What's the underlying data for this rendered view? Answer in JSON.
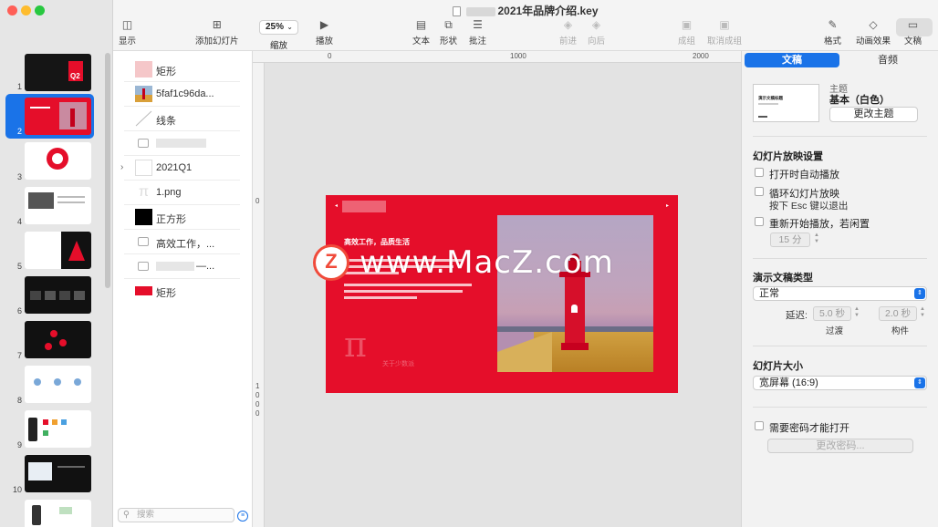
{
  "window": {
    "title": "2021年品牌介绍.key",
    "traffic_lights": {
      "close": "#ff5f57",
      "minimize": "#febc2e",
      "zoom": "#28c840"
    }
  },
  "toolbar": {
    "view_label": "显示",
    "zoom_value": "25%",
    "zoom_label": "缩放",
    "add_slide_label": "添加幻灯片",
    "play_label": "播放",
    "text_label": "文本",
    "shape_label": "形状",
    "comment_label": "批注",
    "forward_label": "前进",
    "backward_label": "向后",
    "group_label": "成组",
    "ungroup_label": "取消成组",
    "format_label": "格式",
    "animate_label": "动画效果",
    "document_label": "文稿"
  },
  "navigator": {
    "selected_index": 2,
    "slides": [
      {
        "num": "1",
        "style": "dark"
      },
      {
        "num": "2",
        "style": "red"
      },
      {
        "num": "3",
        "style": "light"
      },
      {
        "num": "4",
        "style": "light"
      },
      {
        "num": "5",
        "style": "mixed"
      },
      {
        "num": "6",
        "style": "dark"
      },
      {
        "num": "7",
        "style": "dark"
      },
      {
        "num": "8",
        "style": "light"
      },
      {
        "num": "9",
        "style": "light"
      },
      {
        "num": "10",
        "style": "dark"
      },
      {
        "num": "",
        "style": "light"
      }
    ]
  },
  "object_list": {
    "items": [
      {
        "label": "矩形",
        "swatch": "#f5c7c9"
      },
      {
        "label": "5faf1c96da...",
        "swatch": "image"
      },
      {
        "label": "线条",
        "swatch": "line"
      },
      {
        "label": "",
        "swatch": "text"
      },
      {
        "label": "2021Q1",
        "swatch": "group"
      },
      {
        "label": "1.png",
        "swatch": "pi"
      },
      {
        "label": "正方形",
        "swatch": "#000000"
      },
      {
        "label": "高效工作，...",
        "swatch": "text"
      },
      {
        "label": "—...",
        "swatch": "text"
      },
      {
        "label": "矩形",
        "swatch": "#e50e2a"
      }
    ],
    "search_placeholder": "搜索"
  },
  "canvas": {
    "ruler_h": [
      "0",
      "1000",
      "2000"
    ],
    "ruler_v": [
      "0",
      "1000"
    ],
    "slide": {
      "heading": "高效工作，品质生活",
      "footer_text": "关于少数派",
      "pi_glyph": "π"
    }
  },
  "watermark": {
    "text": "www.MacZ.com",
    "badge_letter": "Z"
  },
  "inspector": {
    "tabs": {
      "document": "文稿",
      "audio": "音频"
    },
    "theme": {
      "section_label": "主题",
      "name": "基本（白色）",
      "thumb_title": "演示文稿标题",
      "change_button": "更改主题"
    },
    "slideshow": {
      "title": "幻灯片放映设置",
      "autoplay": "打开时自动播放",
      "loop": "循环幻灯片放映",
      "esc_hint": "按下 Esc 键以退出",
      "restart": "重新开始播放，若闲置",
      "idle_minutes": "15 分"
    },
    "presentation_type": {
      "title": "演示文稿类型",
      "value": "正常",
      "delay_label": "延迟:",
      "transition_value": "5.0 秒",
      "transition_label": "过渡",
      "build_value": "2.0 秒",
      "build_label": "构件"
    },
    "slide_size": {
      "title": "幻灯片大小",
      "value": "宽屏幕 (16:9)"
    },
    "password": {
      "require": "需要密码才能打开",
      "change_button": "更改密码..."
    }
  }
}
